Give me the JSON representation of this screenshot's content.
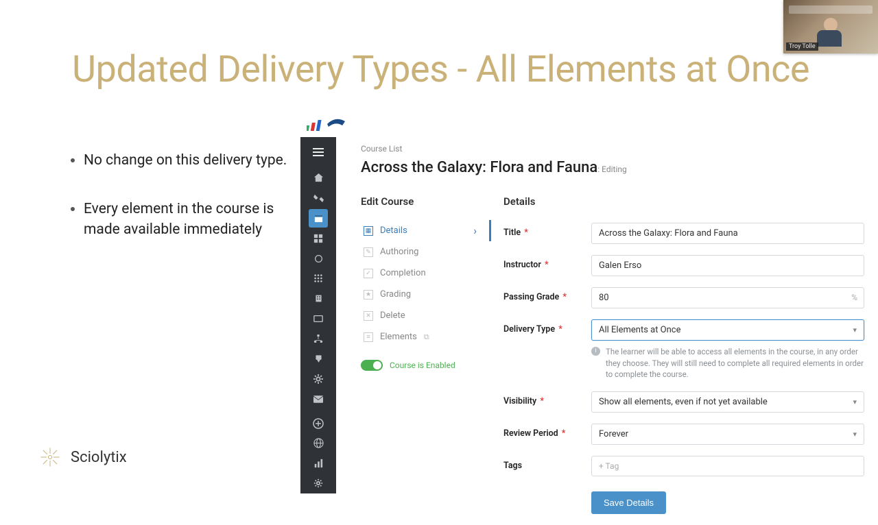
{
  "slide": {
    "title": "Updated Delivery Types - All Elements at Once",
    "bullets": [
      "No change on this delivery type.",
      "Every element in the course is made available immediately"
    ]
  },
  "brand": {
    "name": "Sciolytix"
  },
  "presenter": {
    "name": "Troy Tolle"
  },
  "app": {
    "breadcrumb": "Course List",
    "page_title": "Across the Galaxy: Flora and Fauna",
    "page_title_suffix": ": Editing",
    "edit_header": "Edit Course",
    "edit_items": [
      {
        "label": "Details",
        "active": true
      },
      {
        "label": "Authoring"
      },
      {
        "label": "Completion"
      },
      {
        "label": "Grading"
      },
      {
        "label": "Delete"
      },
      {
        "label": "Elements"
      }
    ],
    "enabled_toggle_label": "Course is Enabled",
    "details_header": "Details",
    "fields": {
      "title_label": "Title",
      "title_value": "Across the Galaxy: Flora and Fauna",
      "instructor_label": "Instructor",
      "instructor_value": "Galen Erso",
      "passing_label": "Passing Grade",
      "passing_value": "80",
      "passing_suffix": "%",
      "delivery_label": "Delivery Type",
      "delivery_value": "All Elements at Once",
      "delivery_help": "The learner will be able to access all elements in the course, in any order they choose. They will still need to complete all required elements in order to complete the course.",
      "visibility_label": "Visibility",
      "visibility_value": "Show all elements, even if not yet available",
      "review_label": "Review Period",
      "review_value": "Forever",
      "tags_label": "Tags",
      "tags_placeholder": "+ Tag"
    },
    "save_label": "Save Details"
  }
}
